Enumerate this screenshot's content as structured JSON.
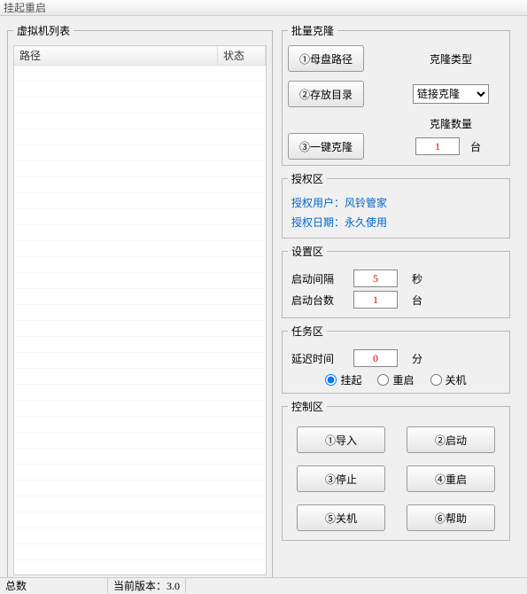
{
  "window_title": "挂起重启",
  "vm_list": {
    "title": "虚拟机列表",
    "columns": {
      "path": "路径",
      "status": "状态"
    },
    "rows": []
  },
  "clone": {
    "title": "批量克隆",
    "btn_mother": "①母盘路径",
    "btn_save": "②存放目录",
    "btn_one_key": "③一键克隆",
    "type_label": "克隆类型",
    "type_value": "链接克隆",
    "count_label": "克隆数量",
    "count_value": "1",
    "count_unit": "台"
  },
  "auth": {
    "title": "授权区",
    "user_label": "授权用户：",
    "user_value": "风铃管家",
    "date_label": "授权日期：",
    "date_value": "永久使用"
  },
  "settings": {
    "title": "设置区",
    "interval_label": "启动间隔",
    "interval_value": "5",
    "interval_unit": "秒",
    "count_label": "启动台数",
    "count_value": "1",
    "count_unit": "台"
  },
  "task": {
    "title": "任务区",
    "delay_label": "延迟时间",
    "delay_value": "0",
    "delay_unit": "分",
    "radio_suspend": "挂起",
    "radio_restart": "重启",
    "radio_shutdown": "关机"
  },
  "control": {
    "title": "控制区",
    "btn_import": "①导入",
    "btn_start": "②启动",
    "btn_stop": "③停止",
    "btn_restart": "④重启",
    "btn_shutdown": "⑤关机",
    "btn_help": "⑥帮助"
  },
  "status_bar": {
    "total_label": "总数",
    "version_label": "当前版本：",
    "version_value": "3.0"
  }
}
